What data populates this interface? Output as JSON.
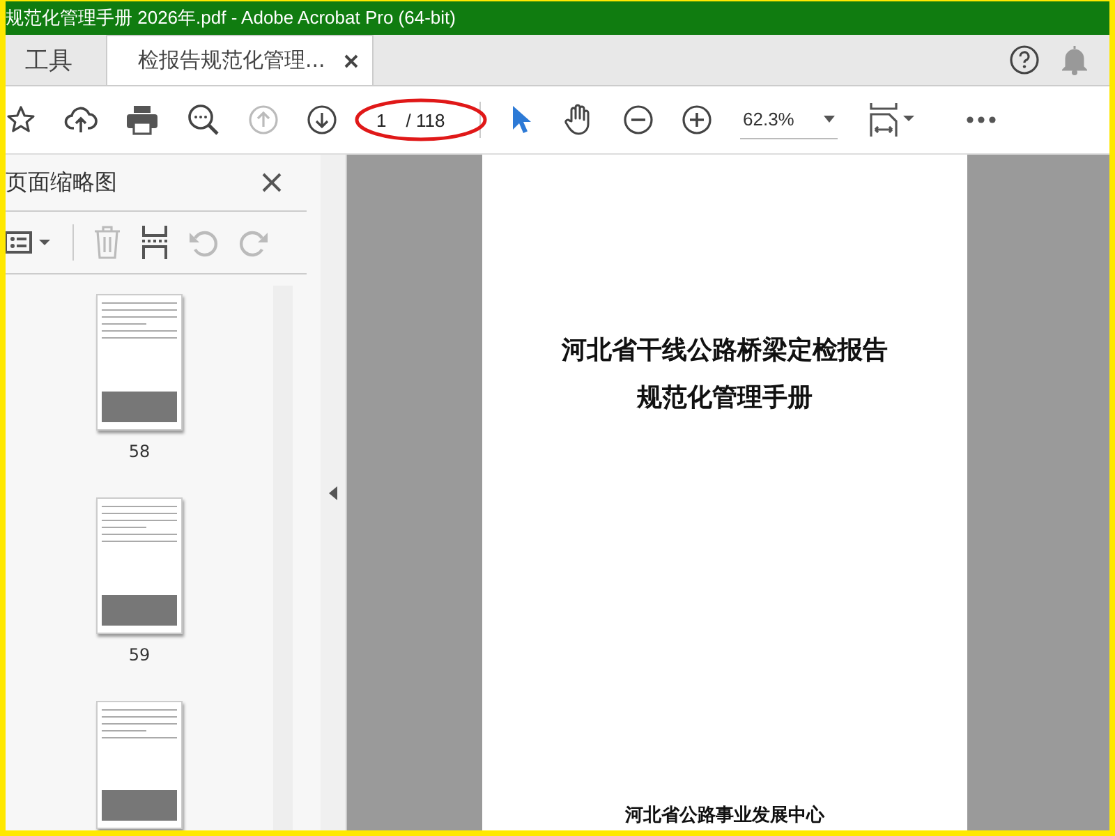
{
  "window": {
    "title": "规范化管理手册 2026年.pdf - Adobe Acrobat Pro (64-bit)"
  },
  "tabs": [
    {
      "label": "工具",
      "selected": false,
      "closable": false
    },
    {
      "label": "检报告规范化管理...",
      "selected": true,
      "closable": true
    }
  ],
  "toolbar": {
    "nav_buttons": [
      {
        "kind": "previous-page",
        "disabled": true
      },
      {
        "kind": "next-page",
        "disabled": false
      }
    ],
    "page_field": {
      "value": "1",
      "total": "/ 118",
      "circled": true
    },
    "tools": [
      {
        "kind": "select",
        "selected": true
      },
      {
        "kind": "hand",
        "selected": false
      }
    ],
    "zoom": {
      "value": "62.3%"
    }
  },
  "sidebar": {
    "title": "页面缩略图",
    "tools": [
      {
        "kind": "options",
        "disabled": false
      },
      {
        "kind": "delete",
        "disabled": true
      },
      {
        "kind": "insert",
        "disabled": false
      },
      {
        "kind": "rotate-left",
        "disabled": true
      },
      {
        "kind": "rotate-right",
        "disabled": true
      }
    ],
    "thumbnails": [
      {
        "label": "58"
      },
      {
        "label": "59"
      }
    ],
    "partial_thumbnail": true
  },
  "document": {
    "title_lines": [
      "河北省干线公路桥梁定检报告",
      "规范化管理手册"
    ],
    "footer": "河北省公路事业发展中心"
  }
}
